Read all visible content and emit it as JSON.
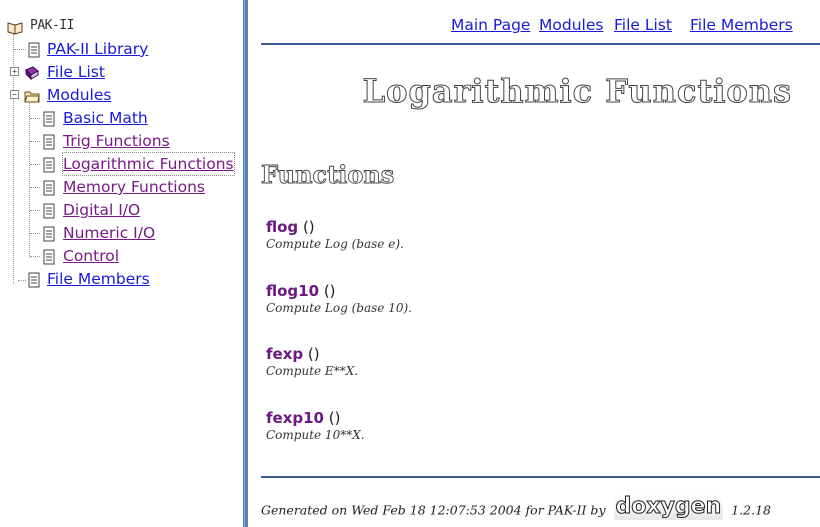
{
  "tree": {
    "root_label": "PAK-II",
    "items": [
      {
        "label": "PAK-II Library",
        "icon": "document-icon"
      },
      {
        "label": "File List",
        "icon": "book-icon"
      },
      {
        "label": "Modules",
        "icon": "folder-icon"
      },
      {
        "label": "Basic Math",
        "icon": "document-icon"
      },
      {
        "label": "Trig Functions",
        "icon": "document-icon"
      },
      {
        "label": "Logarithmic Functions",
        "icon": "document-icon"
      },
      {
        "label": "Memory Functions",
        "icon": "document-icon"
      },
      {
        "label": "Digital I/O",
        "icon": "document-icon"
      },
      {
        "label": "Numeric I/O",
        "icon": "document-icon"
      },
      {
        "label": "Control",
        "icon": "document-icon"
      },
      {
        "label": "File Members",
        "icon": "document-icon"
      }
    ],
    "expand_glyph": "+",
    "collapse_glyph": "−"
  },
  "nav": {
    "main_page": "Main Page",
    "modules": "Modules",
    "file_list": "File List",
    "file_members": "File Members"
  },
  "page_title": "Logarithmic Functions",
  "section_title": "Functions",
  "functions": [
    {
      "name": "flog",
      "paren": " ()",
      "desc": "Compute Log (base e)."
    },
    {
      "name": "flog10",
      "paren": " ()",
      "desc": "Compute Log (base 10)."
    },
    {
      "name": "fexp",
      "paren": " ()",
      "desc": "Compute E**X."
    },
    {
      "name": "fexp10",
      "paren": " ()",
      "desc": "Compute 10**X."
    }
  ],
  "footer": {
    "generated": "Generated on Wed Feb 18 12:07:53 2004 for PAK-II by",
    "logo_text": "doxygen",
    "version": "1.2.18"
  },
  "colors": {
    "link": "#1a1adb",
    "visited": "#7a1a8a",
    "function_name": "#6a1a82",
    "rule": "#3b5b9b",
    "separator": "#5b7dba"
  }
}
